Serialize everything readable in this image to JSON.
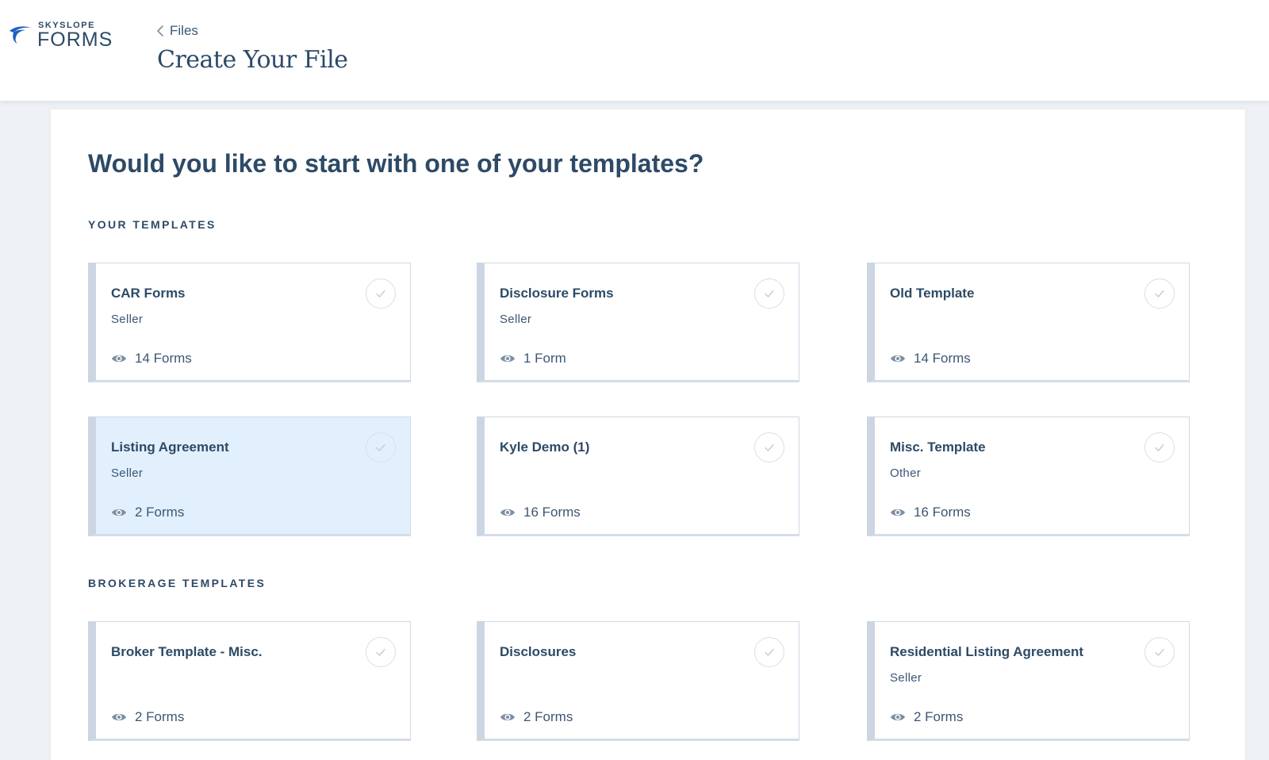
{
  "brand": {
    "top": "SKYSLOPE",
    "main": "FORMS",
    "color": "#1f5fbf"
  },
  "header": {
    "back_label": "Files",
    "title": "Create Your File"
  },
  "main": {
    "question": "Would you like to start with one of your templates?",
    "your_templates": {
      "label": "YOUR TEMPLATES",
      "cards": [
        {
          "title": "CAR Forms",
          "subtitle": "Seller",
          "forms": "14 Forms",
          "selected": false
        },
        {
          "title": "Disclosure Forms",
          "subtitle": "Seller",
          "forms": "1 Form",
          "selected": false
        },
        {
          "title": "Old Template",
          "subtitle": "",
          "forms": "14 Forms",
          "selected": false
        },
        {
          "title": "Listing Agreement",
          "subtitle": "Seller",
          "forms": "2 Forms",
          "selected": true
        },
        {
          "title": "Kyle Demo (1)",
          "subtitle": "",
          "forms": "16 Forms",
          "selected": false
        },
        {
          "title": "Misc. Template",
          "subtitle": "Other",
          "forms": "16 Forms",
          "selected": false
        }
      ]
    },
    "brokerage_templates": {
      "label": "BROKERAGE TEMPLATES",
      "cards": [
        {
          "title": "Broker Template - Misc.",
          "subtitle": "",
          "forms": "2 Forms",
          "selected": false
        },
        {
          "title": "Disclosures",
          "subtitle": "",
          "forms": "2 Forms",
          "selected": false
        },
        {
          "title": "Residential Listing Agreement",
          "subtitle": "Seller",
          "forms": "2 Forms",
          "selected": false
        }
      ]
    }
  },
  "icons": {
    "back": "chevron-left-icon",
    "forms": "eye-icon",
    "select": "check-circle-icon"
  },
  "colors": {
    "text": "#2d4a66",
    "selected_bg": "#e2f0fe",
    "card_accent": "#cbd6e2"
  }
}
